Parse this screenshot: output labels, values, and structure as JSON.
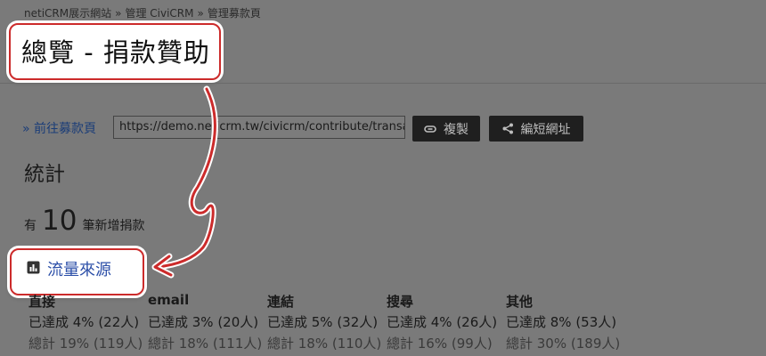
{
  "breadcrumb": [
    "netiCRM展示網站",
    "管理 CiviCRM",
    "管理募款頁"
  ],
  "breadcrumb_separator": "»",
  "page_title": "總覽 - 捐款贊助",
  "goto_link": "» 前往募款頁",
  "url_field": {
    "value": "https://demo.neticrm.tw/civicrm/contribute/transa"
  },
  "buttons": {
    "copy": "複製",
    "shorten": "編短網址"
  },
  "stats_heading": "統計",
  "new_donations": {
    "prefix": "有",
    "count": "10",
    "suffix": "筆新增捐款"
  },
  "traffic_tab": "流量來源",
  "sources": [
    {
      "name": "直接",
      "achieved": "已達成 4% (22人)",
      "total": "總計 19% (119人)"
    },
    {
      "name": "email",
      "achieved": "已達成 3% (20人)",
      "total": "總計 18% (111人)"
    },
    {
      "name": "連結",
      "achieved": "已達成 5% (32人)",
      "total": "總計 18% (110人)"
    },
    {
      "name": "搜尋",
      "achieved": "已達成 4% (26人)",
      "total": "總計 16% (99人)"
    },
    {
      "name": "其他",
      "achieved": "已達成 8% (53人)",
      "total": "總計 30% (189人)"
    }
  ],
  "colors": {
    "annotation": "#cc2b2b",
    "overlay": "#7a7a7a",
    "link": "#2c4fa8"
  },
  "icons": {
    "copy": "link-icon",
    "shorten": "share-icon",
    "traffic": "bar-chart-icon"
  }
}
